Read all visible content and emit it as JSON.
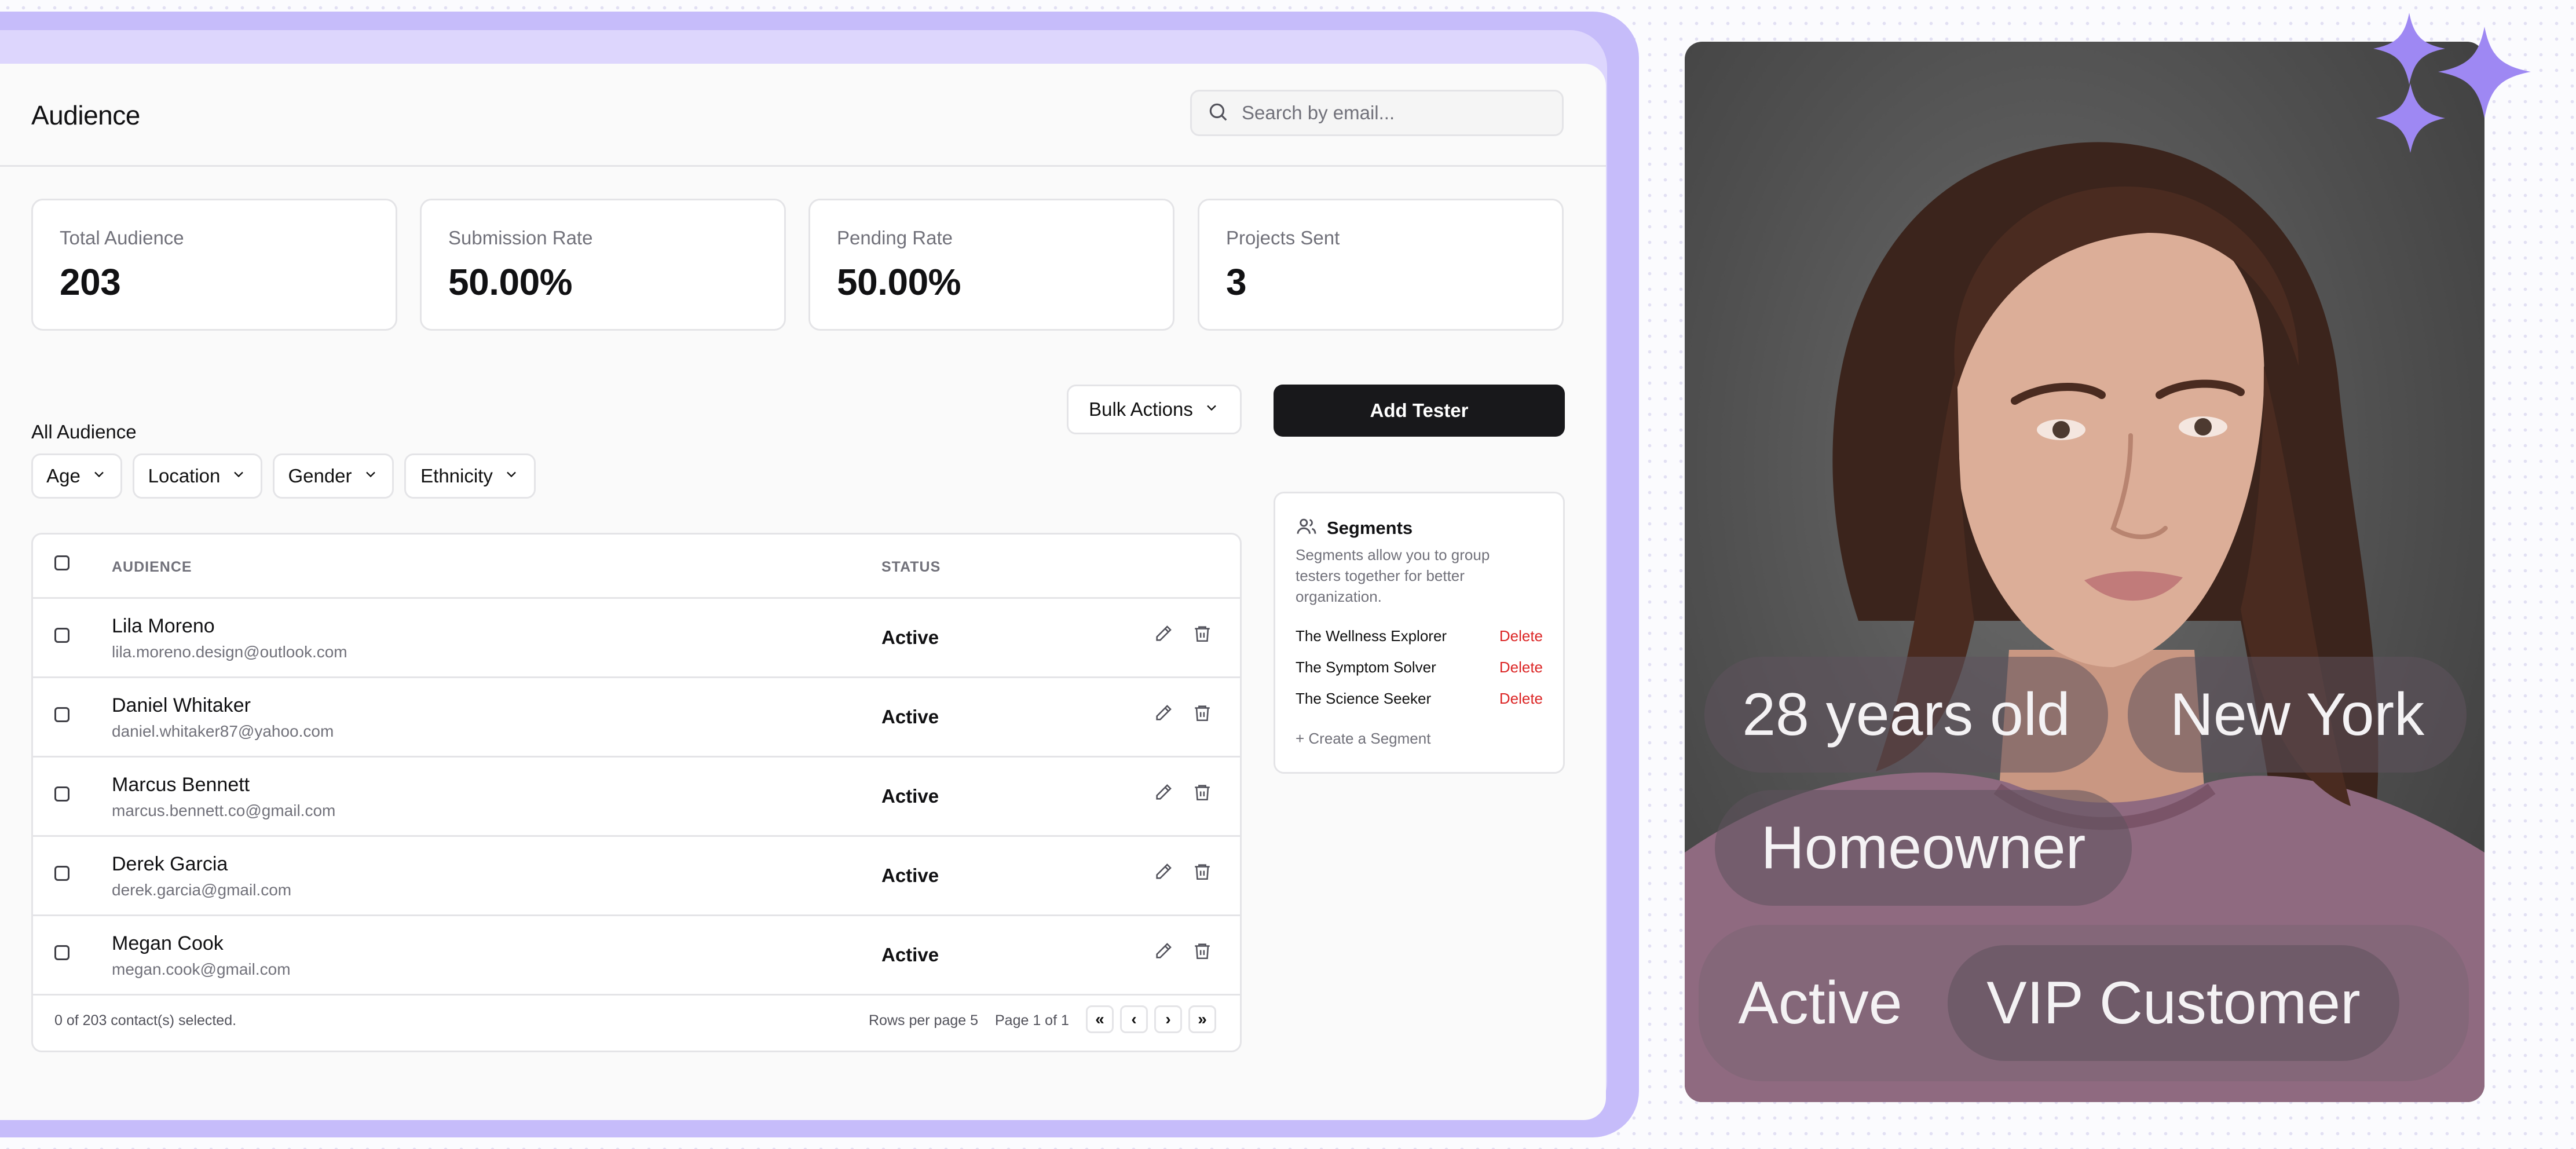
{
  "header": {
    "title": "Audience",
    "search_placeholder": "Search by email..."
  },
  "stats": [
    {
      "label": "Total Audience",
      "value": "203"
    },
    {
      "label": "Submission Rate",
      "value": "50.00%"
    },
    {
      "label": "Pending Rate",
      "value": "50.00%"
    },
    {
      "label": "Projects Sent",
      "value": "3"
    }
  ],
  "section_label": "All Audience",
  "bulk_actions_label": "Bulk Actions",
  "add_tester_label": "Add Tester",
  "filters": [
    "Age",
    "Location",
    "Gender",
    "Ethnicity"
  ],
  "table": {
    "columns": {
      "audience": "AUDIENCE",
      "status": "STATUS"
    },
    "rows": [
      {
        "name": "Lila Moreno",
        "email": "lila.moreno.design@outlook.com",
        "status": "Active"
      },
      {
        "name": "Daniel Whitaker",
        "email": "daniel.whitaker87@yahoo.com",
        "status": "Active"
      },
      {
        "name": "Marcus Bennett",
        "email": "marcus.bennett.co@gmail.com",
        "status": "Active"
      },
      {
        "name": "Derek Garcia",
        "email": "derek.garcia@gmail.com",
        "status": "Active"
      },
      {
        "name": "Megan Cook",
        "email": "megan.cook@gmail.com",
        "status": "Active"
      }
    ],
    "footer": {
      "selected": "0 of 203 contact(s) selected.",
      "rows_per_page": "Rows per page 5",
      "page": "Page 1 of 1",
      "first": "«",
      "prev": "‹",
      "next": "›",
      "last": "»"
    }
  },
  "segments": {
    "title": "Segments",
    "description": "Segments allow you to group testers together for better organization.",
    "items": [
      {
        "name": "The Wellness Explorer",
        "action": "Delete"
      },
      {
        "name": "The Symptom Solver",
        "action": "Delete"
      },
      {
        "name": "The Science Seeker",
        "action": "Delete"
      }
    ],
    "create_label": "+ Create a Segment"
  },
  "persona": {
    "tags": [
      "28 years old",
      "New York",
      "Homeowner",
      "Active",
      "VIP Customer"
    ]
  },
  "colors": {
    "accent": "#c6bcfa",
    "accent_light": "#ddd6fd",
    "sparkle": "#9e88f3",
    "primary_button": "#18181b",
    "danger": "#dc2626"
  }
}
